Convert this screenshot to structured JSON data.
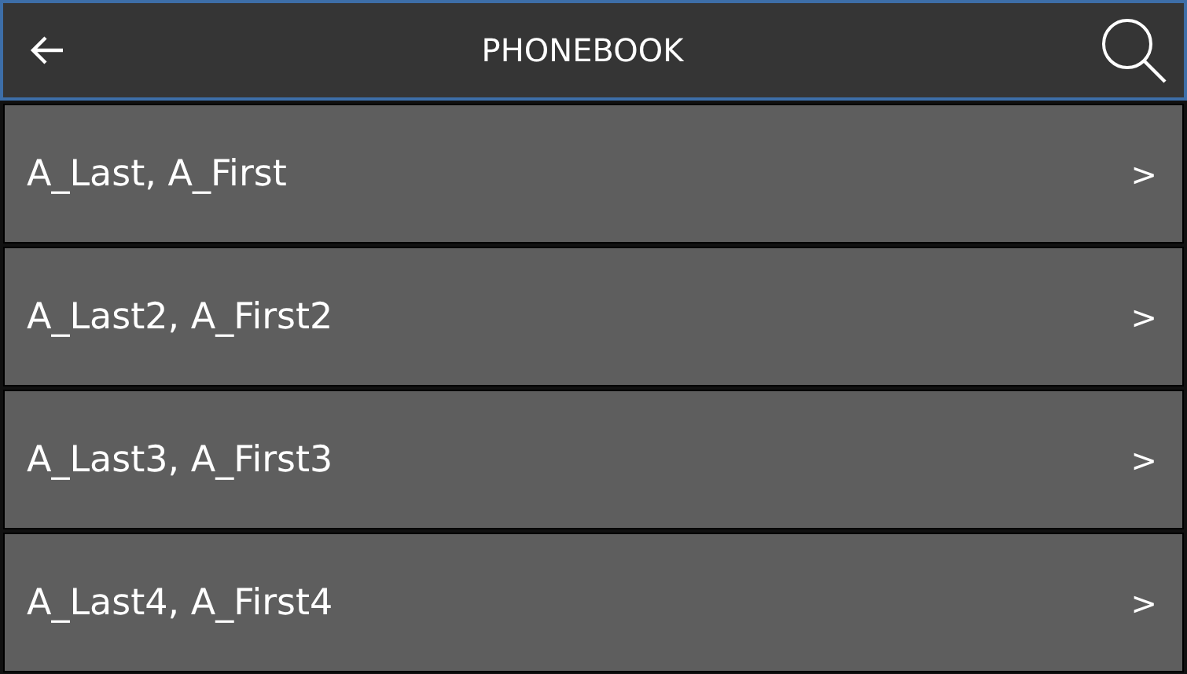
{
  "header": {
    "title": "PHONEBOOK"
  },
  "contacts": [
    {
      "name": "A_Last, A_First",
      "chevron": ">"
    },
    {
      "name": "A_Last2, A_First2",
      "chevron": ">"
    },
    {
      "name": "A_Last3, A_First3",
      "chevron": ">"
    },
    {
      "name": "A_Last4, A_First4",
      "chevron": ">"
    }
  ]
}
